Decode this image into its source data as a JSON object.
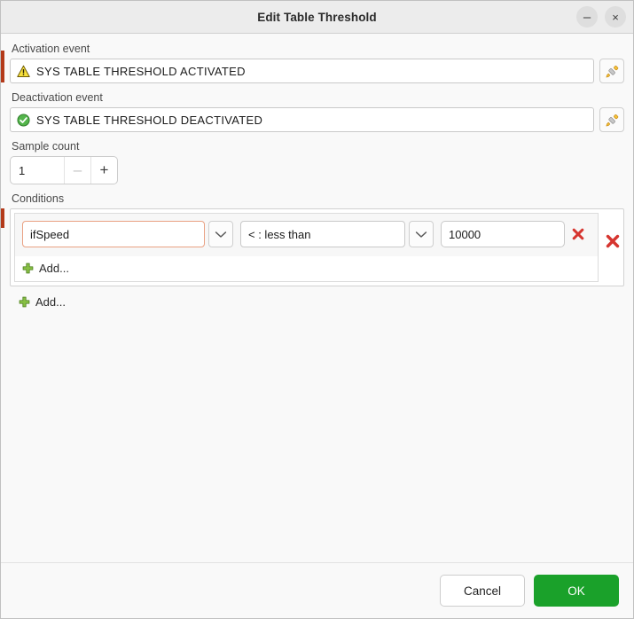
{
  "window": {
    "title": "Edit Table Threshold",
    "minimize_label": "–",
    "close_label": "×"
  },
  "activation": {
    "label": "Activation event",
    "value": "SYS  TABLE  THRESHOLD  ACTIVATED",
    "status_icon": "warning-triangle-icon",
    "picker_icon": "eyedropper-icon"
  },
  "deactivation": {
    "label": "Deactivation event",
    "value": "SYS  TABLE  THRESHOLD  DEACTIVATED",
    "status_icon": "check-circle-icon",
    "picker_icon": "eyedropper-icon"
  },
  "sample_count": {
    "label": "Sample count",
    "value": "1",
    "decrement_label": "–",
    "increment_label": "+"
  },
  "conditions": {
    "label": "Conditions",
    "rows": [
      {
        "attribute": "ifSpeed",
        "operator": "< : less than",
        "value": "10000",
        "delete_icon": "delete-x-icon",
        "attribute_dropdown_icon": "chevron-down-icon",
        "operator_dropdown_icon": "chevron-down-icon"
      }
    ],
    "group_delete_icon": "delete-x-icon",
    "add_condition_label": "Add...",
    "add_group_label": "Add...",
    "add_icon": "plus-icon"
  },
  "footer": {
    "cancel_label": "Cancel",
    "ok_label": "OK"
  },
  "colors": {
    "ok_button": "#1aa12a",
    "error_marker": "#b33a1a",
    "invalid_border": "#e9a183",
    "warning": "#f2d024",
    "success": "#4caf50",
    "delete": "#d93a3a",
    "add": "#79bb3f"
  }
}
